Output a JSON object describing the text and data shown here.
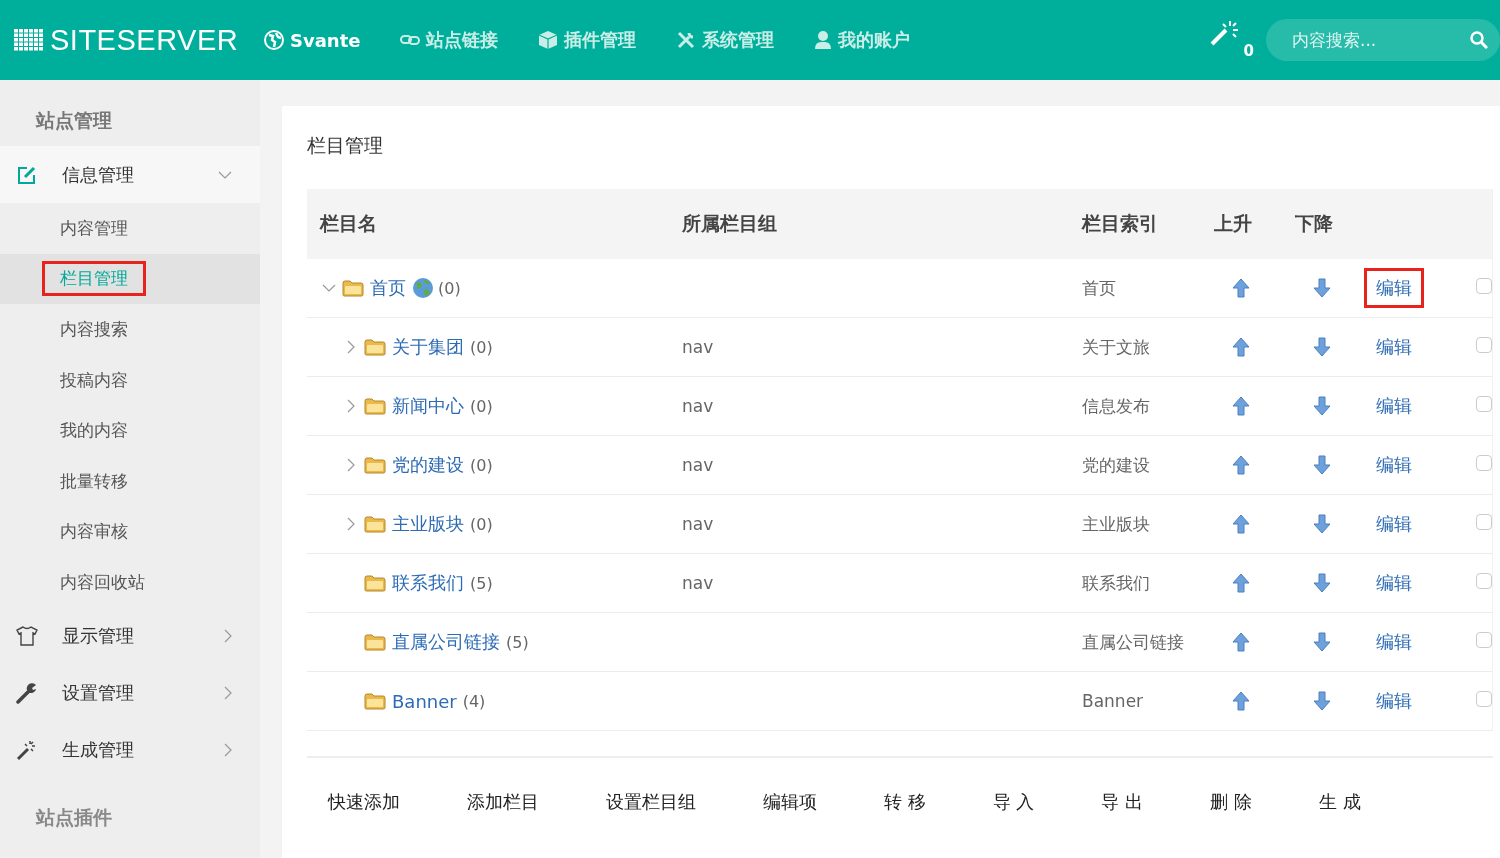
{
  "topbar": {
    "brand": "SITESERVER",
    "nav": [
      {
        "label": "Svante",
        "selected": true
      },
      {
        "label": "站点链接",
        "selected": false
      },
      {
        "label": "插件管理",
        "selected": false
      },
      {
        "label": "系统管理",
        "selected": false
      },
      {
        "label": "我的账户",
        "selected": false
      }
    ],
    "notification_count": "0",
    "search": {
      "placeholder": "内容搜索..."
    }
  },
  "sidebar": {
    "heading": "站点管理",
    "groups": [
      {
        "label": "信息管理",
        "expanded": true,
        "children": [
          {
            "label": "内容管理",
            "selected": false
          },
          {
            "label": "栏目管理",
            "selected": true
          },
          {
            "label": "内容搜索",
            "selected": false
          },
          {
            "label": "投稿内容",
            "selected": false
          },
          {
            "label": "我的内容",
            "selected": false
          },
          {
            "label": "批量转移",
            "selected": false
          },
          {
            "label": "内容审核",
            "selected": false
          },
          {
            "label": "内容回收站",
            "selected": false
          }
        ]
      },
      {
        "label": "显示管理",
        "expanded": false
      },
      {
        "label": "设置管理",
        "expanded": false
      },
      {
        "label": "生成管理",
        "expanded": false
      }
    ],
    "footer_heading": "站点插件"
  },
  "panel": {
    "title": "栏目管理",
    "table": {
      "columns": [
        "栏目名",
        "所属栏目组",
        "栏目索引",
        "上升",
        "下降"
      ],
      "rows": [
        {
          "name": "首页",
          "home": true,
          "count": "(0)",
          "index": "首页",
          "expanded": true,
          "edit": "编辑",
          "edit_highlighted": true,
          "checked": false,
          "children": [
            {
              "name": "关于集团",
              "home": false,
              "count": "(0)",
              "group": "nav",
              "index": "关于文旅",
              "expanded": false,
              "edit": "编辑",
              "edit_highlighted": false,
              "checked": false
            },
            {
              "name": "新闻中心",
              "home": false,
              "count": "(0)",
              "group": "nav",
              "index": "信息发布",
              "expanded": false,
              "edit": "编辑",
              "edit_highlighted": false,
              "checked": false
            },
            {
              "name": "党的建设",
              "home": false,
              "count": "(0)",
              "group": "nav",
              "index": "党的建设",
              "expanded": false,
              "edit": "编辑",
              "edit_highlighted": false,
              "checked": false
            },
            {
              "name": "主业版块",
              "home": false,
              "count": "(0)",
              "group": "nav",
              "index": "主业版块",
              "expanded": false,
              "edit": "编辑",
              "edit_highlighted": false,
              "checked": false
            },
            {
              "name": "联系我们",
              "home": false,
              "count": "(5)",
              "group": "nav",
              "index": "联系我们",
              "edit": "编辑",
              "edit_highlighted": false,
              "checked": false
            },
            {
              "name": "直属公司链接",
              "home": false,
              "count": "(5)",
              "index": "直属公司链接",
              "edit": "编辑",
              "edit_highlighted": false,
              "checked": false
            },
            {
              "name": "Banner",
              "home": false,
              "count": "(4)",
              "index": "Banner",
              "edit": "编辑",
              "edit_highlighted": false,
              "checked": false
            }
          ]
        }
      ]
    },
    "actions": [
      "快速添加",
      "添加栏目",
      "设置栏目组",
      "编辑项",
      "转 移",
      "导 入",
      "导 出",
      "删 除",
      "生 成"
    ]
  }
}
